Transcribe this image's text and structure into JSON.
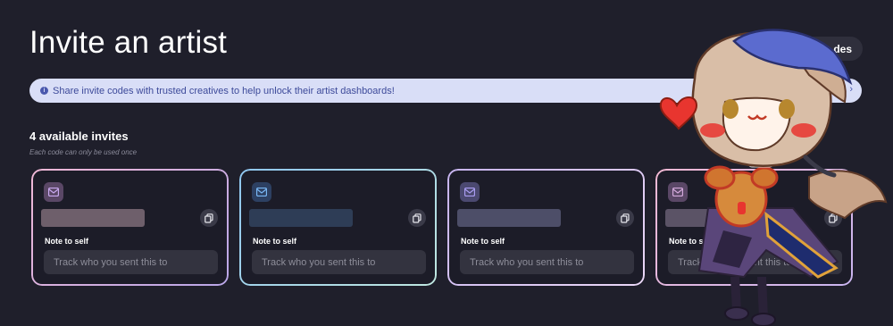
{
  "header": {
    "title": "Invite an artist",
    "codes_button_label": "des"
  },
  "banner": {
    "text": "Share invite codes with trusted creatives to help unlock their artist dashboards!"
  },
  "invites": {
    "heading": "4 available invites",
    "subheading": "Each code can only be used once",
    "cards": [
      {
        "note_label": "Note to self",
        "note_placeholder": "Track who you sent this to",
        "note_value": "",
        "border": [
          "#f0b8d6",
          "#b9a6e8"
        ],
        "accent": "#c9a9f0",
        "icon_bg": "#5a4766",
        "code_color": "#6e5f6b"
      },
      {
        "note_label": "Note to self",
        "note_placeholder": "Track who you sent this to",
        "note_value": "",
        "border": [
          "#8fc6f0",
          "#bfe7e0"
        ],
        "accent": "#79b7f5",
        "icon_bg": "#2d4062",
        "code_color": "#2e3d56"
      },
      {
        "note_label": "Note to self",
        "note_placeholder": "Track who you sent this to",
        "note_value": "",
        "border": [
          "#c7b4f0",
          "#ead7f6"
        ],
        "accent": "#aa9df2",
        "icon_bg": "#4b4970",
        "code_color": "#4d4e68"
      },
      {
        "note_label": "Note to self",
        "note_placeholder": "Track who you sent this to",
        "note_value": "",
        "border": [
          "#f4b9d4",
          "#c9b5f0"
        ],
        "accent": "#d4a9dc",
        "icon_bg": "#5a4766",
        "code_color": "#5b5366"
      }
    ]
  },
  "icons": {
    "info": "info-icon",
    "ticket": "ticket-icon",
    "copy": "copy-icon",
    "close": "close-icon"
  }
}
